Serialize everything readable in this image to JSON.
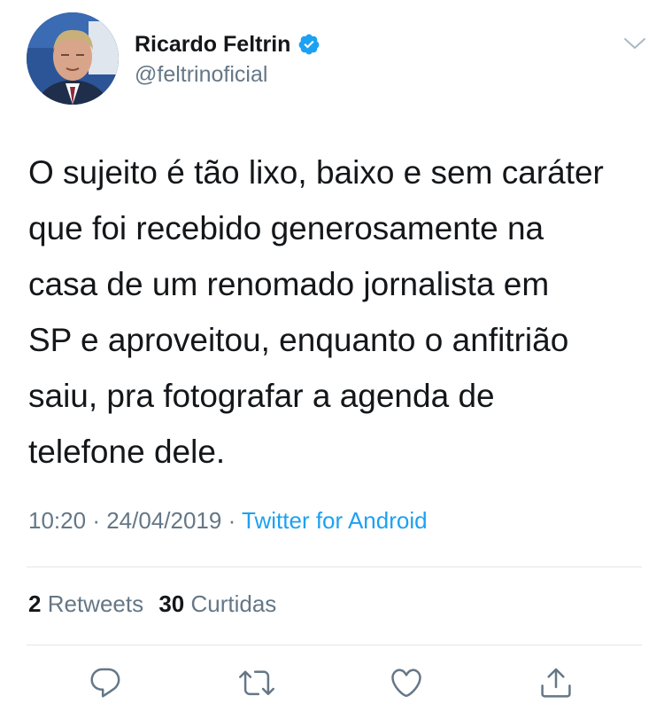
{
  "tweet": {
    "author": {
      "display_name": "Ricardo Feltrin",
      "handle": "@feltrinoficial",
      "verified": true
    },
    "text": "O sujeito é tão lixo, baixo e sem caráter\nque foi recebido generosamente na\ncasa de um renomado jornalista em\nSP e aproveitou, enquanto o anfitrião\nsaiu, pra fotografar a agenda de\ntelefone dele.",
    "time": "10:20",
    "date": "24/04/2019",
    "separator": "·",
    "source": "Twitter for Android",
    "stats": {
      "retweets_count": "2",
      "retweets_label": "Retweets",
      "likes_count": "30",
      "likes_label": "Curtidas"
    }
  },
  "icons": {
    "verified": "verified-badge-icon",
    "more": "chevron-down-icon",
    "reply": "reply-icon",
    "retweet": "retweet-icon",
    "like": "heart-icon",
    "share": "share-icon"
  },
  "colors": {
    "text": "#14171a",
    "secondary": "#657786",
    "link": "#1da1f2",
    "verified": "#1da1f2",
    "divider": "#e1e8ed"
  }
}
